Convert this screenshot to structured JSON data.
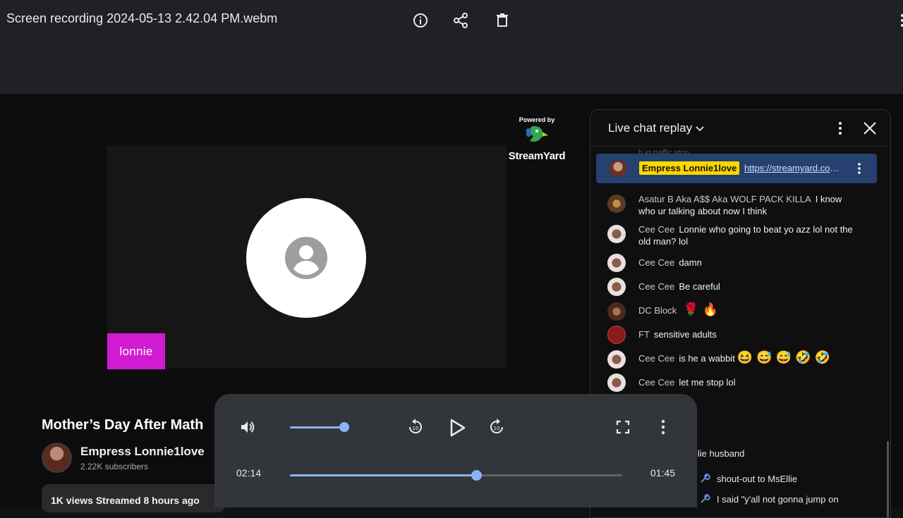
{
  "window": {
    "file_title": "Screen recording 2024-05-13 2.42.04 PM.webm",
    "icons": [
      "info-icon",
      "share-icon",
      "delete-icon",
      "more-vert-icon"
    ]
  },
  "video": {
    "participant_name": "lonnie",
    "branding_top": "Powered by",
    "branding_name": "StreamYard",
    "title": "Mother’s Day After Math",
    "channel": "Empress Lonnie1love",
    "subscribers": "2.22K subscribers",
    "stats": "1K views  Streamed 8 hours ago"
  },
  "chat": {
    "title": "Live chat replay",
    "faded_top": "h in traffic stop",
    "pinned": {
      "author": "Empress Lonnie1love",
      "link": "https://streamyard.com/..."
    },
    "messages": [
      {
        "author": "Asatur B Aka A$$ Aka WOLF PACK KILLA",
        "text": "I know who ur talking about now I think",
        "emoji": ""
      },
      {
        "author": "Cee Cee",
        "text": "Lonnie who going to beat yo azz lol not the old man? lol",
        "emoji": ""
      },
      {
        "author": "Cee Cee",
        "text": "damn",
        "emoji": ""
      },
      {
        "author": "Cee Cee",
        "text": "Be careful",
        "emoji": ""
      },
      {
        "author": "DC Block",
        "text": "",
        "emoji": "🌹 🔥"
      },
      {
        "author": "FT",
        "text": "sensitive adults",
        "emoji": ""
      },
      {
        "author": "Cee Cee",
        "text": "is he a wabbit",
        "emoji": "😆 😅 😅 🤣 🤣"
      },
      {
        "author": "Cee Cee",
        "text": "let me stop lol",
        "emoji": ""
      }
    ],
    "partial_lines": [
      "llie husband",
      "shout-out to MsEllie",
      "I said \"y'all not gonna jump on"
    ]
  },
  "player": {
    "current_time": "02:14",
    "remaining_time": "01:45",
    "progress": 0.56,
    "volume": 0.9
  },
  "colors": {
    "accent": "#8ab4f8",
    "name_tag": "#d11bd1",
    "pinned_bg": "#26406f",
    "pinned_author_bg": "#ffd600"
  }
}
